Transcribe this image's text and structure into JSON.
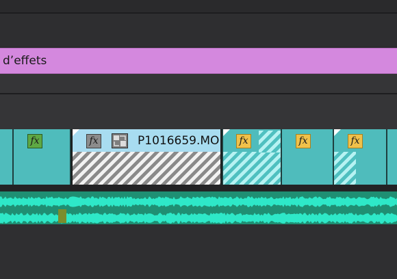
{
  "adjustment_layer": {
    "label": "d’effets",
    "color": "#d488de"
  },
  "video_clips": [
    {
      "id": "clip-a",
      "fx": "fx",
      "fx_state": "green"
    },
    {
      "id": "clip-b",
      "fx": "fx",
      "fx_state": "gray",
      "name": "P1016659.MO",
      "selected": true
    },
    {
      "id": "clip-c",
      "fx": "fx",
      "fx_state": "yellow"
    },
    {
      "id": "clip-d",
      "fx": "fx",
      "fx_state": "yellow"
    },
    {
      "id": "clip-e",
      "fx": "fx",
      "fx_state": "yellow"
    }
  ],
  "colors": {
    "background": "#2b2b2d",
    "clip_teal": "#4fbcbc",
    "clip_selected": "#a8dcf0",
    "audio_bg": "#1f8f73",
    "audio_wave": "#2ee8c8",
    "audio_marker": "#7c8c2c"
  },
  "icons": {
    "fx_badge": "fx-icon",
    "transition": "transition-icon"
  }
}
